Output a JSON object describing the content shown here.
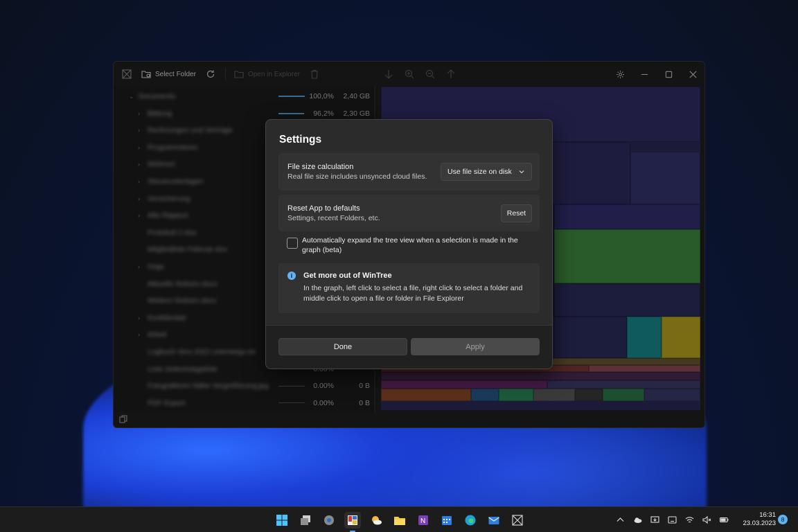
{
  "window": {
    "toolbar": {
      "select_folder_label": "Select Folder",
      "open_in_explorer_label": "Open in Explorer"
    },
    "tree": {
      "rows": [
        {
          "name": "Documents",
          "pct": "100,0%",
          "size": "2,40 GB",
          "indent": 0,
          "chev": "⌄",
          "bar": 1.0
        },
        {
          "name": "Bildung",
          "pct": "96,2%",
          "size": "2,30 GB",
          "indent": 1,
          "chev": "›",
          "bar": 0.962
        },
        {
          "name": "Rechnungen und Verträge",
          "pct": "",
          "size": "",
          "indent": 1,
          "chev": "›",
          "bar": null
        },
        {
          "name": "Programmieren",
          "pct": "",
          "size": "",
          "indent": 1,
          "chev": "›",
          "bar": null
        },
        {
          "name": "Wohnort",
          "pct": "",
          "size": "",
          "indent": 1,
          "chev": "›",
          "bar": null
        },
        {
          "name": "Steuerunterlagen",
          "pct": "",
          "size": "",
          "indent": 1,
          "chev": "›",
          "bar": null
        },
        {
          "name": "Versicherung",
          "pct": "",
          "size": "",
          "indent": 1,
          "chev": "›",
          "bar": null
        },
        {
          "name": "Alte Rapport",
          "pct": "",
          "size": "",
          "indent": 1,
          "chev": "›",
          "bar": null
        },
        {
          "name": "Protokoll 2.xlsx",
          "pct": "",
          "size": "",
          "indent": 1,
          "chev": "",
          "bar": null
        },
        {
          "name": "Mitgliedliste Februar.xlsx",
          "pct": "",
          "size": "",
          "indent": 1,
          "chev": "",
          "bar": null
        },
        {
          "name": "Orga",
          "pct": "",
          "size": "",
          "indent": 1,
          "chev": "›",
          "bar": null
        },
        {
          "name": "Aktuelle Notizen.docx",
          "pct": "",
          "size": "",
          "indent": 1,
          "chev": "",
          "bar": null
        },
        {
          "name": "Weitere Notizen.docx",
          "pct": "",
          "size": "",
          "indent": 1,
          "chev": "",
          "bar": null
        },
        {
          "name": "Konfidential",
          "pct": "",
          "size": "",
          "indent": 1,
          "chev": "›",
          "bar": null
        },
        {
          "name": "Arbeit",
          "pct": "",
          "size": "",
          "indent": 1,
          "chev": "›",
          "bar": null
        },
        {
          "name": "Logbuch Vers 2022 unterwegs.txt",
          "pct": "",
          "size": "",
          "indent": 1,
          "chev": "",
          "bar": null
        },
        {
          "name": "Liste Geburtstagsliste",
          "pct": "0.00%",
          "size": "",
          "indent": 1,
          "chev": "",
          "bar": 0
        },
        {
          "name": "Fotografieren Nähe Vergrößerung.jpg",
          "pct": "0.00%",
          "size": "0 B",
          "indent": 1,
          "chev": "",
          "bar": 0
        },
        {
          "name": "PDF Export",
          "pct": "0.00%",
          "size": "0 B",
          "indent": 1,
          "chev": "",
          "bar": 0
        }
      ]
    }
  },
  "dialog": {
    "title": "Settings",
    "file_size": {
      "title": "File size calculation",
      "description": "Real file size includes unsynced cloud files.",
      "selected": "Use file size on disk"
    },
    "reset": {
      "title": "Reset App to defaults",
      "description": "Settings, recent Folders, etc.",
      "button": "Reset"
    },
    "auto_expand": {
      "label": "Automatically expand the tree view when a selection is made in the graph (beta)",
      "checked": false
    },
    "info": {
      "title": "Get more out of WinTree",
      "body": "In the graph, left click to select a file, right click to select a folder and middle click to open a file or folder in File Explorer"
    },
    "done_label": "Done",
    "apply_label": "Apply"
  },
  "taskbar": {
    "apps": [
      "windows-start",
      "task-view",
      "settings",
      "wintree",
      "weather",
      "file-explorer",
      "onenote",
      "calendar",
      "edge",
      "mail",
      "wintree-alt"
    ],
    "time": "16:31",
    "date": "23.03.2023",
    "notification_count": "8"
  },
  "colors": {
    "accent": "#60a8f0",
    "treemap_base": "#2a2a58",
    "treemap_green": "#3f8a3f"
  }
}
